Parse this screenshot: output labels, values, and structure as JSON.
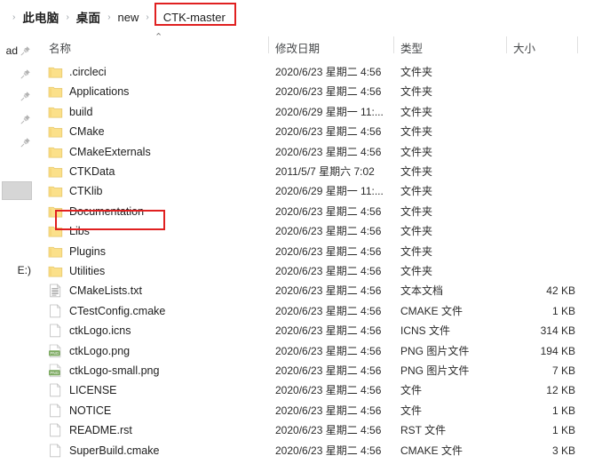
{
  "window": {
    "title": "CTK-master"
  },
  "addressbar": {
    "name": "address-bar",
    "separator": "›",
    "crumbs": [
      {
        "label": "此电脑",
        "style": "cjk"
      },
      {
        "label": "桌面",
        "style": "cjk"
      },
      {
        "label": "new",
        "style": "latin"
      },
      {
        "label": "CTK-master",
        "style": "latin",
        "highlighted": true
      }
    ],
    "highlight_color": "#e02020"
  },
  "navpane": {
    "quick_access_items": [
      {
        "label": "ad",
        "icon": "pin-icon"
      },
      {
        "label": "",
        "icon": "pin-icon"
      },
      {
        "label": "",
        "icon": "pin-icon"
      },
      {
        "label": "",
        "icon": "pin-icon"
      },
      {
        "label": "",
        "icon": "pin-icon"
      }
    ],
    "selected_item_label": "",
    "drive_label": "E:)"
  },
  "columns": {
    "name": "名称",
    "date_modified": "修改日期",
    "type": "类型",
    "size": "大小",
    "sort_indicator": "⌃"
  },
  "files": [
    {
      "name": ".circleci",
      "icon": "folder-icon",
      "date": "2020/6/23 星期二 4:56",
      "type": "文件夹",
      "size": ""
    },
    {
      "name": "Applications",
      "icon": "folder-icon",
      "date": "2020/6/23 星期二 4:56",
      "type": "文件夹",
      "size": ""
    },
    {
      "name": "build",
      "icon": "folder-icon",
      "date": "2020/6/29 星期一 11:...",
      "type": "文件夹",
      "size": ""
    },
    {
      "name": "CMake",
      "icon": "folder-icon",
      "date": "2020/6/23 星期二 4:56",
      "type": "文件夹",
      "size": ""
    },
    {
      "name": "CMakeExternals",
      "icon": "folder-icon",
      "date": "2020/6/23 星期二 4:56",
      "type": "文件夹",
      "size": ""
    },
    {
      "name": "CTKData",
      "icon": "folder-icon",
      "date": "2011/5/7 星期六 7:02",
      "type": "文件夹",
      "size": "",
      "highlighted": true
    },
    {
      "name": "CTKlib",
      "icon": "folder-icon",
      "date": "2020/6/29 星期一 11:...",
      "type": "文件夹",
      "size": ""
    },
    {
      "name": "Documentation",
      "icon": "folder-icon",
      "date": "2020/6/23 星期二 4:56",
      "type": "文件夹",
      "size": ""
    },
    {
      "name": "Libs",
      "icon": "folder-icon",
      "date": "2020/6/23 星期二 4:56",
      "type": "文件夹",
      "size": ""
    },
    {
      "name": "Plugins",
      "icon": "folder-icon",
      "date": "2020/6/23 星期二 4:56",
      "type": "文件夹",
      "size": ""
    },
    {
      "name": "Utilities",
      "icon": "folder-icon",
      "date": "2020/6/23 星期二 4:56",
      "type": "文件夹",
      "size": ""
    },
    {
      "name": "CMakeLists.txt",
      "icon": "text-file-icon",
      "date": "2020/6/23 星期二 4:56",
      "type": "文本文档",
      "size": "42 KB"
    },
    {
      "name": "CTestConfig.cmake",
      "icon": "blank-file-icon",
      "date": "2020/6/23 星期二 4:56",
      "type": "CMAKE 文件",
      "size": "1 KB"
    },
    {
      "name": "ctkLogo.icns",
      "icon": "blank-file-icon",
      "date": "2020/6/23 星期二 4:56",
      "type": "ICNS 文件",
      "size": "314 KB"
    },
    {
      "name": "ctkLogo.png",
      "icon": "png-file-icon",
      "date": "2020/6/23 星期二 4:56",
      "type": "PNG 图片文件",
      "size": "194 KB"
    },
    {
      "name": "ctkLogo-small.png",
      "icon": "png-file-icon",
      "date": "2020/6/23 星期二 4:56",
      "type": "PNG 图片文件",
      "size": "7 KB"
    },
    {
      "name": "LICENSE",
      "icon": "blank-file-icon",
      "date": "2020/6/23 星期二 4:56",
      "type": "文件",
      "size": "12 KB"
    },
    {
      "name": "NOTICE",
      "icon": "blank-file-icon",
      "date": "2020/6/23 星期二 4:56",
      "type": "文件",
      "size": "1 KB"
    },
    {
      "name": "README.rst",
      "icon": "blank-file-icon",
      "date": "2020/6/23 星期二 4:56",
      "type": "RST 文件",
      "size": "1 KB"
    },
    {
      "name": "SuperBuild.cmake",
      "icon": "blank-file-icon",
      "date": "2020/6/23 星期二 4:56",
      "type": "CMAKE 文件",
      "size": "3 KB"
    }
  ],
  "colors": {
    "folder": "#fbe08a",
    "folder_edge": "#e8c96a",
    "png": "#78a45c",
    "highlight": "#e02020",
    "header_text": "#46484a"
  }
}
